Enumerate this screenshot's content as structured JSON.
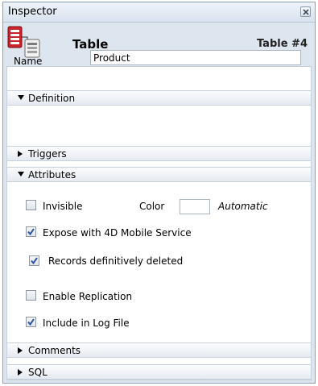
{
  "window": {
    "title": "Inspector"
  },
  "header": {
    "title": "Table",
    "table_number": "Table #4"
  },
  "sections": {
    "definition": "Definition",
    "triggers": "Triggers",
    "attributes": "Attributes",
    "comments": "Comments",
    "sql": "SQL"
  },
  "definition": {
    "name_label": "Name",
    "name_value": "Product"
  },
  "attributes": {
    "invisible": {
      "label": "Invisible",
      "checked": false
    },
    "color_label": "Color",
    "color_value": "Automatic",
    "expose_mobile": {
      "label": "Expose with 4D Mobile Service",
      "checked": true
    },
    "records_deleted": {
      "label": "Records definitively deleted",
      "checked": true
    },
    "enable_replication": {
      "label": "Enable Replication",
      "checked": false
    },
    "include_log": {
      "label": "Include in Log File",
      "checked": true
    }
  },
  "colors": {
    "panel_bg": "#dde5ef",
    "border": "#8e9fb4",
    "check": "#2f55a8"
  }
}
